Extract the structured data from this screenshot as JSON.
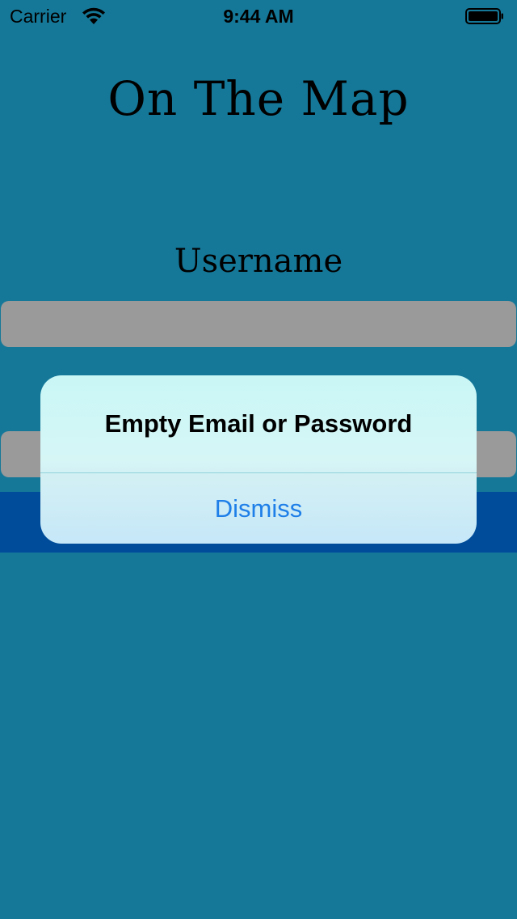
{
  "status_bar": {
    "carrier": "Carrier",
    "time": "9:44 AM",
    "wifi_icon": "wifi-icon",
    "battery_icon": "battery-icon"
  },
  "app": {
    "title": "On The Map",
    "username_label": "Username",
    "username_value": "",
    "password_value": "",
    "login_label": ""
  },
  "alert": {
    "title": "Empty Email or Password",
    "dismiss_label": "Dismiss"
  },
  "colors": {
    "background": "#157899",
    "field": "#9a9a9a",
    "login_button": "#004c9a",
    "alert_action": "#1f7fe8"
  }
}
